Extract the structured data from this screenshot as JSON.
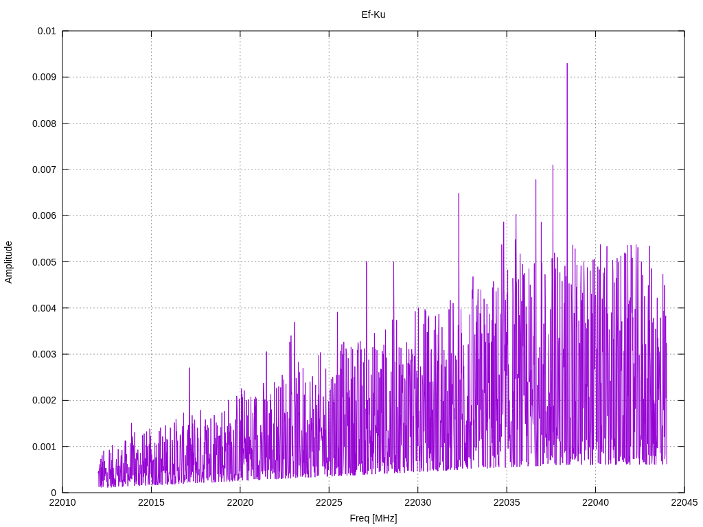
{
  "plot": {
    "title": "Ef-Ku",
    "xlabel": "Freq [MHz]",
    "ylabel": "Amplitude",
    "x_ticks": [
      "22010",
      "22015",
      "22020",
      "22025",
      "22030",
      "22035",
      "22040",
      "22045"
    ],
    "y_ticks": [
      "0.01",
      "0.009",
      "0.008",
      "0.007",
      "0.006",
      "0.005",
      "0.004",
      "0.003",
      "0.002",
      "0.001",
      "0"
    ]
  }
}
